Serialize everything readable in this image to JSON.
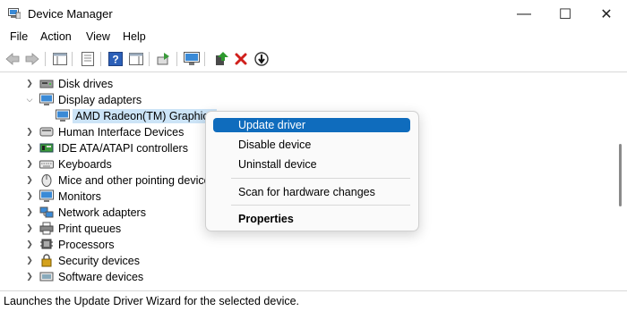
{
  "window": {
    "title": "Device Manager"
  },
  "controls": {
    "minimize": "—",
    "maximize": "☐",
    "close": "✕"
  },
  "menu": [
    "File",
    "Action",
    "View",
    "Help"
  ],
  "toolbar": {
    "icons": [
      "back-arrow-icon",
      "forward-arrow-icon",
      "show-hide-console-tree-icon",
      "properties-icon",
      "help-icon",
      "action-pane-icon",
      "export-icon",
      "monitor-icon",
      "update-driver-icon",
      "uninstall-device-icon",
      "disable-device-icon"
    ]
  },
  "tree": {
    "items": [
      {
        "label": "Disk drives",
        "expanded": false
      },
      {
        "label": "Display adapters",
        "expanded": true
      },
      {
        "label": "AMD Radeon(TM) Graphics",
        "child": true,
        "selected": true
      },
      {
        "label": "Human Interface Devices",
        "expanded": false
      },
      {
        "label": "IDE ATA/ATAPI controllers",
        "expanded": false
      },
      {
        "label": "Keyboards",
        "expanded": false
      },
      {
        "label": "Mice and other pointing devices",
        "expanded": false
      },
      {
        "label": "Monitors",
        "expanded": false
      },
      {
        "label": "Network adapters",
        "expanded": false
      },
      {
        "label": "Print queues",
        "expanded": false
      },
      {
        "label": "Processors",
        "expanded": false
      },
      {
        "label": "Security devices",
        "expanded": false
      },
      {
        "label": "Software devices",
        "expanded": false
      }
    ]
  },
  "context_menu": {
    "items": [
      "Update driver",
      "Disable device",
      "Uninstall device",
      "Scan for hardware changes",
      "Properties"
    ],
    "highlighted": "Update driver",
    "bold": "Properties"
  },
  "status": {
    "text": "Launches the Update Driver Wizard for the selected device."
  },
  "colors": {
    "highlight": "#0f6cbd",
    "selection": "#cce4f7"
  }
}
